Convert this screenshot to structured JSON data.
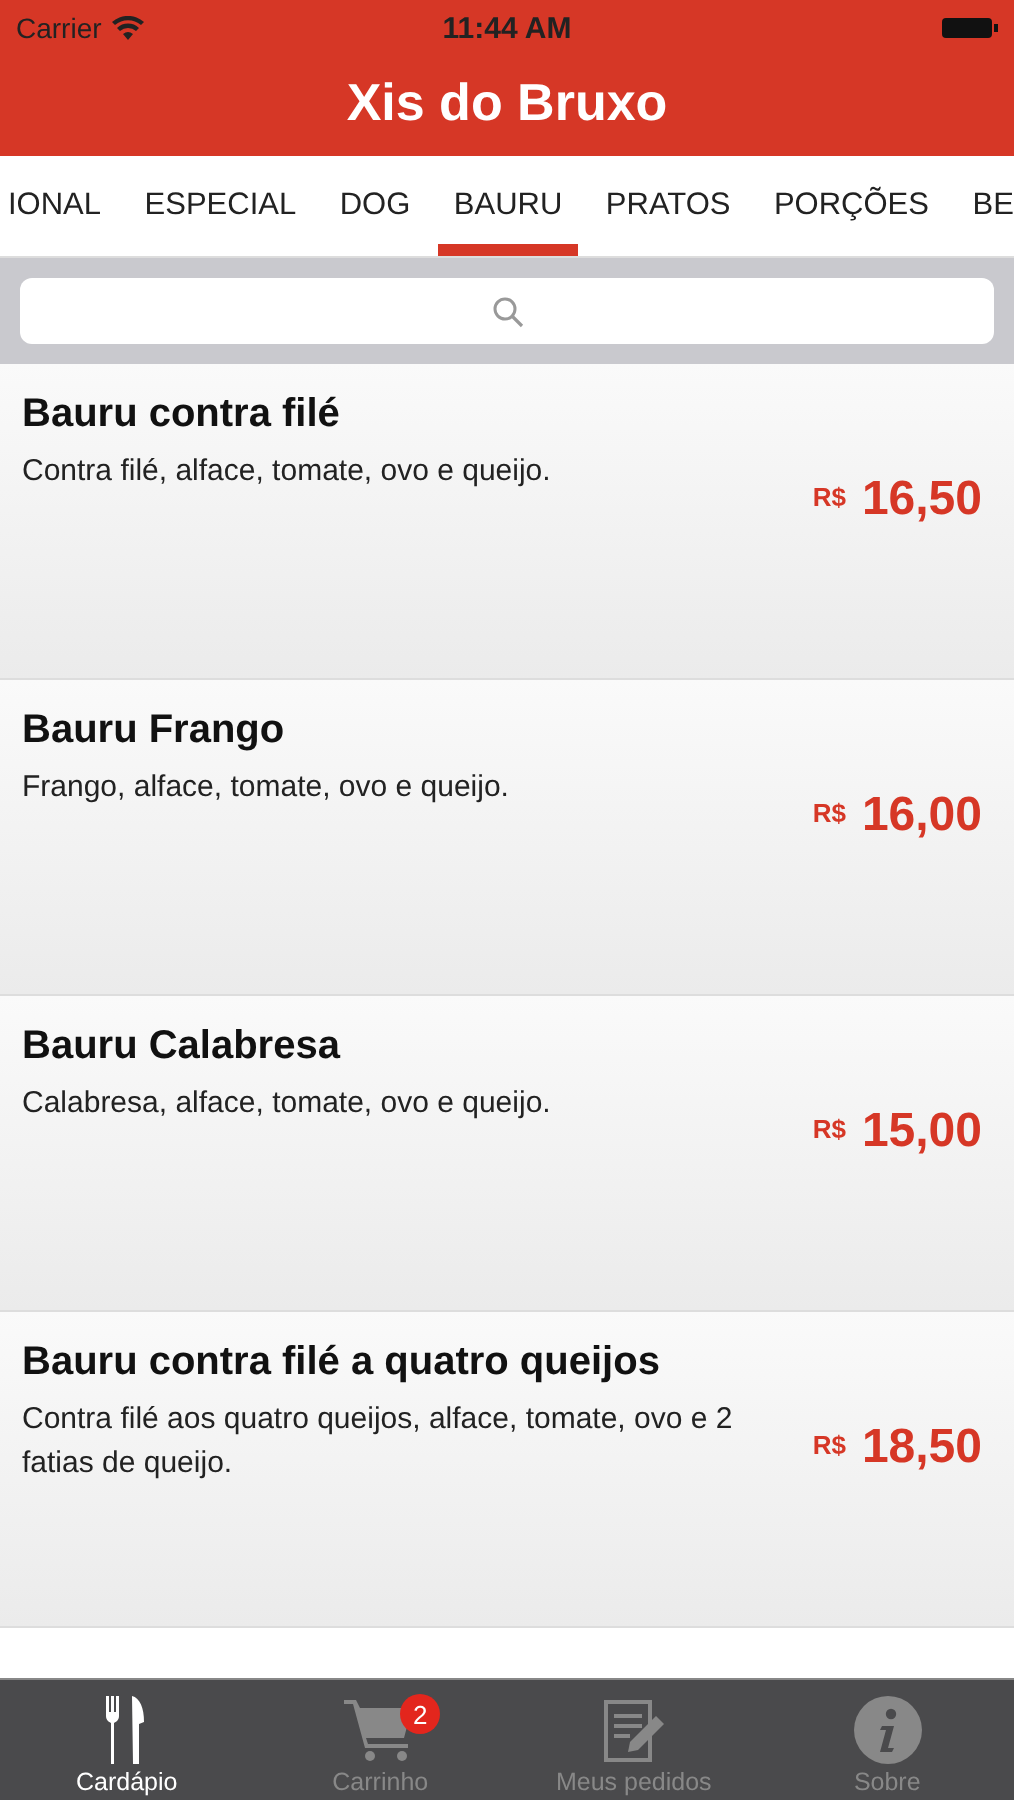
{
  "status_bar": {
    "carrier": "Carrier",
    "time": "11:44 AM"
  },
  "title": "Xis do Bruxo",
  "tabs": [
    {
      "label": "IONAL",
      "selected": false
    },
    {
      "label": "ESPECIAL",
      "selected": false
    },
    {
      "label": "DOG",
      "selected": false
    },
    {
      "label": "BAURU",
      "selected": true
    },
    {
      "label": "PRATOS",
      "selected": false
    },
    {
      "label": "PORÇÕES",
      "selected": false
    },
    {
      "label": "BE",
      "selected": false
    }
  ],
  "items": [
    {
      "name": "Bauru contra filé",
      "description": "Contra filé, alface, tomate, ovo e queijo.",
      "currency": "R$",
      "price": "16,50"
    },
    {
      "name": "Bauru Frango",
      "description": "Frango, alface, tomate, ovo e queijo.",
      "currency": "R$",
      "price": "16,00"
    },
    {
      "name": "Bauru Calabresa",
      "description": "Calabresa, alface, tomate, ovo e queijo.",
      "currency": "R$",
      "price": "15,00"
    },
    {
      "name": "Bauru contra filé a quatro queijos",
      "description": "Contra filé aos quatro queijos, alface, tomate, ovo e 2 fatias de queijo.",
      "currency": "R$",
      "price": "18,50"
    }
  ],
  "tab_bar": [
    {
      "label": "Cardápio",
      "kind": "menu",
      "selected": true
    },
    {
      "label": "Carrinho",
      "kind": "cart",
      "selected": false,
      "badge": "2"
    },
    {
      "label": "Meus pedidos",
      "kind": "orders",
      "selected": false
    },
    {
      "label": "Sobre",
      "kind": "info",
      "selected": false
    }
  ]
}
